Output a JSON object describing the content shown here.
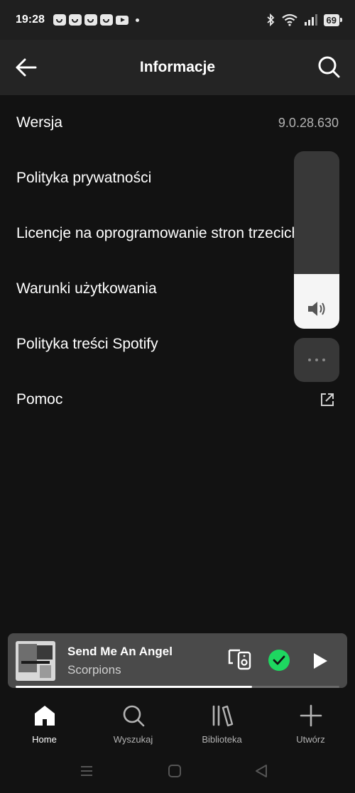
{
  "status_bar": {
    "time": "19:28",
    "battery": "69",
    "notifications": [
      "app-icon",
      "app-icon",
      "app-icon",
      "app-icon",
      "youtube-icon"
    ]
  },
  "header": {
    "title": "Informacje"
  },
  "info_rows": [
    {
      "label": "Wersja",
      "value": "9.0.28.630"
    },
    {
      "label": "Polityka prywatności"
    },
    {
      "label": "Licencje na oprogramowanie stron trzecich"
    },
    {
      "label": "Warunki użytkowania"
    },
    {
      "label": "Polityka treści Spotify"
    },
    {
      "label": "Pomoc"
    }
  ],
  "volume": {
    "level_percent": 31
  },
  "player": {
    "title": "Send Me An Angel",
    "artist": "Scorpions",
    "progress_fraction": 0.73
  },
  "bottom_nav": [
    {
      "label": "Home",
      "icon": "home-icon",
      "active": true
    },
    {
      "label": "Wyszukaj",
      "icon": "search-icon",
      "active": false
    },
    {
      "label": "Biblioteka",
      "icon": "library-icon",
      "active": false
    },
    {
      "label": "Utwórz",
      "icon": "plus-icon",
      "active": false
    }
  ],
  "colors": {
    "background": "#121212",
    "header": "#242424",
    "accent_green": "#1ed760",
    "player_bg": "#4a4a4a"
  }
}
